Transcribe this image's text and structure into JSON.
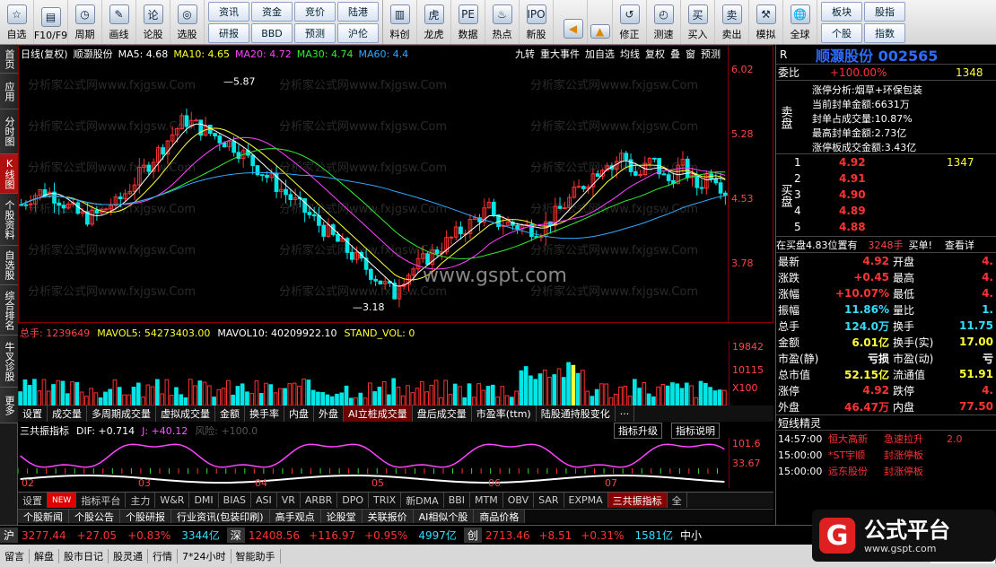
{
  "toolbar": {
    "left_buttons": [
      {
        "label": "自选"
      },
      {
        "label": "F10/F9"
      },
      {
        "label": "周期"
      },
      {
        "label": "画线"
      },
      {
        "label": "论股"
      },
      {
        "label": "选股"
      }
    ],
    "grid1": [
      "资讯",
      "资金",
      "竞价",
      "陆港",
      "研报",
      "BBD",
      "预测",
      "沪伦"
    ],
    "mid_buttons": [
      {
        "label": "料创"
      },
      {
        "label": "龙虎"
      },
      {
        "label": "数据"
      },
      {
        "label": "热点"
      },
      {
        "label": "新股"
      }
    ],
    "right_buttons": [
      {
        "label": "修正"
      },
      {
        "label": "测速"
      },
      {
        "label": "买入"
      },
      {
        "label": "卖出"
      },
      {
        "label": "模拟"
      },
      {
        "label": "全球"
      }
    ],
    "grid2": [
      "板块",
      "股指",
      "个股",
      "指数"
    ]
  },
  "left_tabs": [
    "首页",
    "应用",
    "分时图",
    "K线图",
    "个股资料",
    "自选股",
    "综合排名",
    "牛叉诊股",
    "更多"
  ],
  "main": {
    "period": "日线(复权)",
    "stock": "顺灏股份",
    "ma": [
      {
        "name": "MA5: 4.68",
        "color": "#ffffff"
      },
      {
        "name": "MA10: 4.65",
        "color": "#ffff33"
      },
      {
        "name": "MA20: 4.72",
        "color": "#ff44ff"
      },
      {
        "name": "MA30: 4.74",
        "color": "#33ee33"
      },
      {
        "name": "MA60: 4.4",
        "color": "#33aaff"
      }
    ],
    "buttons": [
      "九转",
      "重大事件",
      "加自选",
      "均线",
      "复权",
      "叠",
      "窗",
      "预测"
    ],
    "y_ticks": [
      "6.02",
      "5.28",
      "4.53",
      "3.78"
    ],
    "high_label": "5.87",
    "low_label": "3.18",
    "watermark": "www.gspt.com",
    "faint_watermark": "分析家公式网www.fxjgsw.Com"
  },
  "vol": {
    "head": "总手: 1239649",
    "mavol5": "MAVOL5: 54273403.00",
    "mavol10": "MAVOL10: 40209922.10",
    "stand": "STAND_VOL: 0",
    "y_ticks": [
      "19842",
      "10115",
      "X100"
    ],
    "tabs": [
      "设置",
      "成交量",
      "多周期成交量",
      "虚拟成交量",
      "金额",
      "换手率",
      "内盘",
      "外盘",
      "AI立桩成交量",
      "盘后成交量",
      "市盈率(ttm)",
      "陆股通持股变化",
      "···"
    ]
  },
  "ind": {
    "name": "三共振指标",
    "dif": "DIF: +0.714",
    "j": "J: +40.12",
    "risk": "风险: +100.0",
    "btn1": "指标升级",
    "btn2": "指标说明",
    "y_ticks": [
      "101.6",
      "33.67"
    ],
    "x_labels": [
      "02",
      "03",
      "04",
      "05",
      "06",
      "07"
    ]
  },
  "bottom_tabs": [
    "设置",
    "NEW",
    "指标平台",
    "主力",
    "W&R",
    "DMI",
    "BIAS",
    "ASI",
    "VR",
    "ARBR",
    "DPO",
    "TRIX",
    "新DMA",
    "BBI",
    "MTM",
    "OBV",
    "SAR",
    "EXPMA",
    "三共振指标",
    "全"
  ],
  "bottom2": [
    "个股新闻",
    "个股公告",
    "个股研报",
    "行业资讯(包装印刷)",
    "高手观点",
    "论股堂",
    "关联报价",
    "AI相似个股",
    "商品价格"
  ],
  "status": {
    "sh_label": "沪",
    "sh_val": "3277.44",
    "sh_chg": "+27.05",
    "sh_pct": "+0.83%",
    "sh_amt": "3344亿",
    "sz_label": "深",
    "sz_val": "12408.56",
    "sz_chg": "+116.97",
    "sz_pct": "+0.95%",
    "sz_amt": "4997亿",
    "cy_label": "创",
    "cy_val": "2713.46",
    "cy_chg": "+8.51",
    "cy_pct": "+0.31%",
    "cy_amt": "1581亿",
    "extra": "中小"
  },
  "bot3": [
    "留言",
    "解盘",
    "股市日记",
    "股灵通",
    "行情",
    "7*24小时",
    "智能助手",
    "代码/名称/简"
  ],
  "right": {
    "r_label": "R",
    "stock_title": "顺灏股份 002565",
    "weibi_label": "委比",
    "weibi_val": "+100.00%",
    "weibi_n": "1348",
    "sell_label": "卖盘",
    "zt_title": "涨停分析:烟草+环保包装",
    "zt_lines": [
      "当前封单金额:6631万",
      "封单占成交量:10.87%",
      "最高封单金额:2.73亿",
      "涨停板成交金额:3.43亿"
    ],
    "buy_label": "买盘",
    "bids": [
      {
        "n": "1",
        "p": "4.92",
        "v": "1347"
      },
      {
        "n": "2",
        "p": "4.91",
        "v": ""
      },
      {
        "n": "3",
        "p": "4.90",
        "v": ""
      },
      {
        "n": "4",
        "p": "4.89",
        "v": ""
      },
      {
        "n": "5",
        "p": "4.88",
        "v": ""
      }
    ],
    "inbuy": "在买盘4.83位置有",
    "inbuy_v": "3248手",
    "inbuy_t": "买单!",
    "inbuy_b": "查看详",
    "quotes": [
      {
        "l": "最新",
        "v": "4.92",
        "l2": "开盘",
        "v2": "4.",
        "c": "red"
      },
      {
        "l": "涨跌",
        "v": "+0.45",
        "l2": "最高",
        "v2": "4.",
        "c": "red"
      },
      {
        "l": "涨幅",
        "v": "+10.07%",
        "l2": "最低",
        "v2": "4.",
        "c": "red"
      },
      {
        "l": "振幅",
        "v": "11.86%",
        "l2": "量比",
        "v2": "1.",
        "c": "cy"
      },
      {
        "l": "总手",
        "v": "124.0万",
        "l2": "换手",
        "v2": "11.75",
        "c": "cy"
      },
      {
        "l": "金额",
        "v": "6.01亿",
        "l2": "换手(实)",
        "v2": "17.00",
        "c": "yel"
      },
      {
        "l": "市盈(静)",
        "v": "亏损",
        "l2": "市盈(动)",
        "v2": "亏",
        "c": "wh"
      },
      {
        "l": "总市值",
        "v": "52.15亿",
        "l2": "流通值",
        "v2": "51.91",
        "c": "yel"
      },
      {
        "l": "涨停",
        "v": "4.92",
        "l2": "跌停",
        "v2": "4.",
        "c": "red"
      },
      {
        "l": "外盘",
        "v": "46.47万",
        "l2": "内盘",
        "v2": "77.50",
        "c": "red"
      }
    ],
    "dxjl": "短线精灵",
    "alerts": [
      {
        "t": "14:57:00",
        "n": "恒大高新",
        "a": "急速拉升",
        "v": "2.0"
      },
      {
        "t": "15:00:00",
        "n": "*ST宇顺",
        "a": "封涨停板",
        "v": ""
      },
      {
        "t": "15:00:00",
        "n": "远东股份",
        "a": "封涨停板",
        "v": ""
      }
    ],
    "tab": "细"
  },
  "logo": {
    "g": "G",
    "text": "公式平台",
    "url": "www.gspt.com"
  },
  "chart_data": {
    "type": "candlestick",
    "ylim": [
      3.0,
      6.1
    ],
    "high": 5.87,
    "low": 3.18
  }
}
